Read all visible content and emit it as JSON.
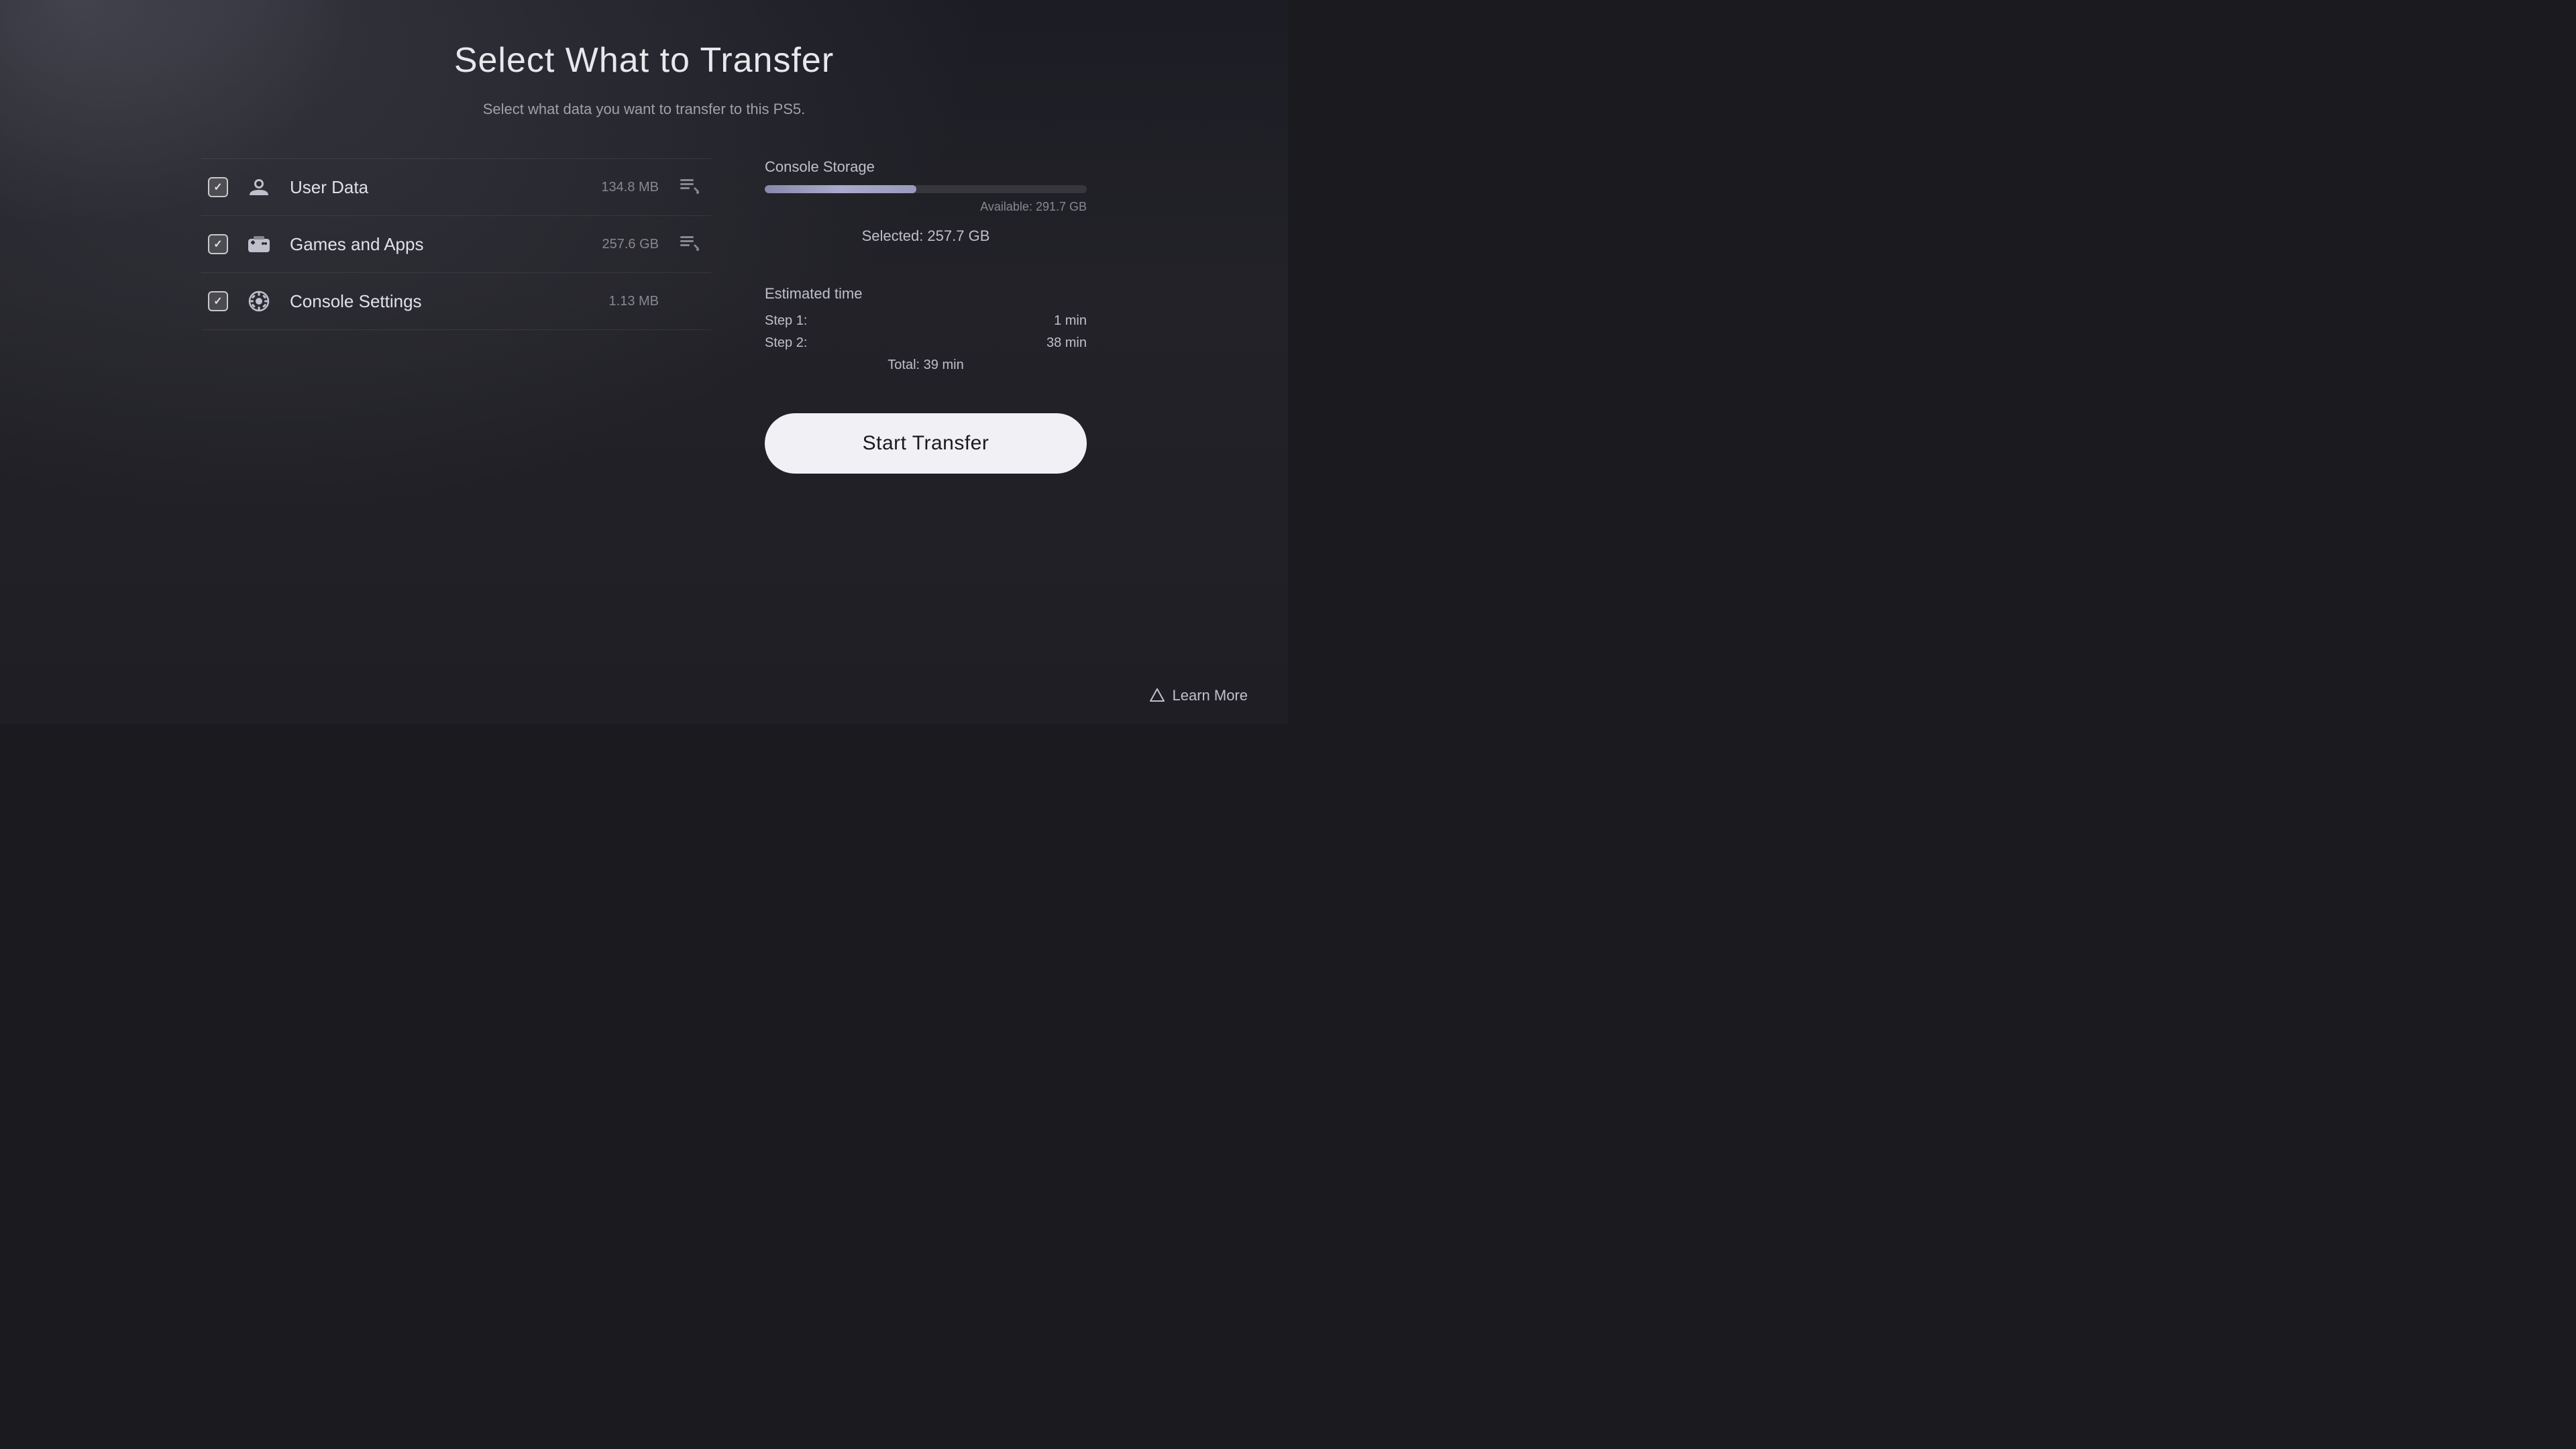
{
  "page": {
    "title": "Select What to Transfer",
    "subtitle": "Select what data you want to transfer to this PS5."
  },
  "transfer_items": [
    {
      "id": "user-data",
      "label": "User Data",
      "size": "134.8 MB",
      "checked": true,
      "has_detail": true
    },
    {
      "id": "games-apps",
      "label": "Games and Apps",
      "size": "257.6 GB",
      "checked": true,
      "has_detail": true
    },
    {
      "id": "console-settings",
      "label": "Console Settings",
      "size": "1.13 MB",
      "checked": true,
      "has_detail": false
    }
  ],
  "storage": {
    "title": "Console Storage",
    "available_label": "Available: 291.7 GB",
    "selected_label": "Selected: 257.7 GB",
    "used_percent": 47
  },
  "estimated_time": {
    "title": "Estimated time",
    "step1_label": "Step 1:",
    "step1_value": "1 min",
    "step2_label": "Step 2:",
    "step2_value": "38 min",
    "total_label": "Total: 39 min"
  },
  "buttons": {
    "start_transfer": "Start Transfer",
    "learn_more": "Learn More"
  },
  "icons": {
    "user_data": "user-data-icon",
    "games_apps": "games-apps-icon",
    "console_settings": "settings-icon",
    "detail": "detail-icon",
    "triangle": "triangle-icon",
    "checkmark": "✓"
  }
}
